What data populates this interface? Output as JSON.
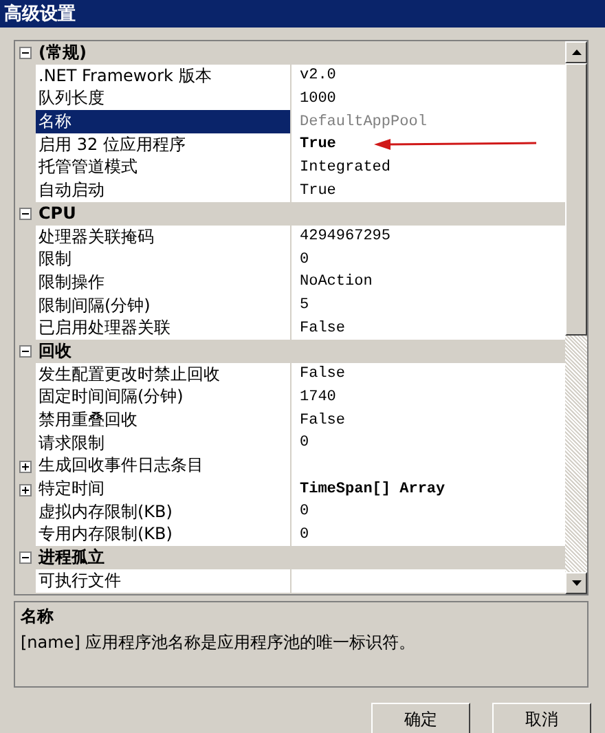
{
  "window": {
    "title": "高级设置"
  },
  "groups": [
    {
      "label": "(常规)",
      "expanded": true,
      "rows": [
        {
          "label": ".NET Framework 版本",
          "value": "v2.0",
          "selected": false
        },
        {
          "label": "队列长度",
          "value": "1000",
          "selected": false
        },
        {
          "label": "名称",
          "value": "DefaultAppPool",
          "selected": true,
          "readonly": true
        },
        {
          "label": "启用 32 位应用程序",
          "value": "True",
          "selected": false,
          "modified": true,
          "annotated": true
        },
        {
          "label": "托管管道模式",
          "value": "Integrated",
          "selected": false
        },
        {
          "label": "自动启动",
          "value": "True",
          "selected": false
        }
      ]
    },
    {
      "label": "CPU",
      "expanded": true,
      "rows": [
        {
          "label": "处理器关联掩码",
          "value": "4294967295",
          "selected": false
        },
        {
          "label": "限制",
          "value": "0",
          "selected": false
        },
        {
          "label": "限制操作",
          "value": "NoAction",
          "selected": false
        },
        {
          "label": "限制间隔(分钟)",
          "value": "5",
          "selected": false
        },
        {
          "label": "已启用处理器关联",
          "value": "False",
          "selected": false
        }
      ]
    },
    {
      "label": "回收",
      "expanded": true,
      "rows": [
        {
          "label": "发生配置更改时禁止回收",
          "value": "False",
          "selected": false
        },
        {
          "label": "固定时间间隔(分钟)",
          "value": "1740",
          "selected": false
        },
        {
          "label": "禁用重叠回收",
          "value": "False",
          "selected": false
        },
        {
          "label": "请求限制",
          "value": "0",
          "selected": false
        },
        {
          "label": "生成回收事件日志条目",
          "selected": false,
          "expanded": false
        },
        {
          "label": "特定时间",
          "value": "TimeSpan[] Array",
          "selected": false,
          "modified": true,
          "expanded": false
        },
        {
          "label": "虚拟内存限制(KB)",
          "value": "0",
          "selected": false
        },
        {
          "label": "专用内存限制(KB)",
          "value": "0",
          "selected": false
        }
      ]
    },
    {
      "label": "进程孤立",
      "expanded": true,
      "rows": [
        {
          "label": "可执行文件",
          "selected": false
        }
      ]
    }
  ],
  "description": {
    "title": "名称",
    "text": "[name] 应用程序池名称是应用程序池的唯一标识符。"
  },
  "buttons": [
    "确定",
    "取消"
  ]
}
